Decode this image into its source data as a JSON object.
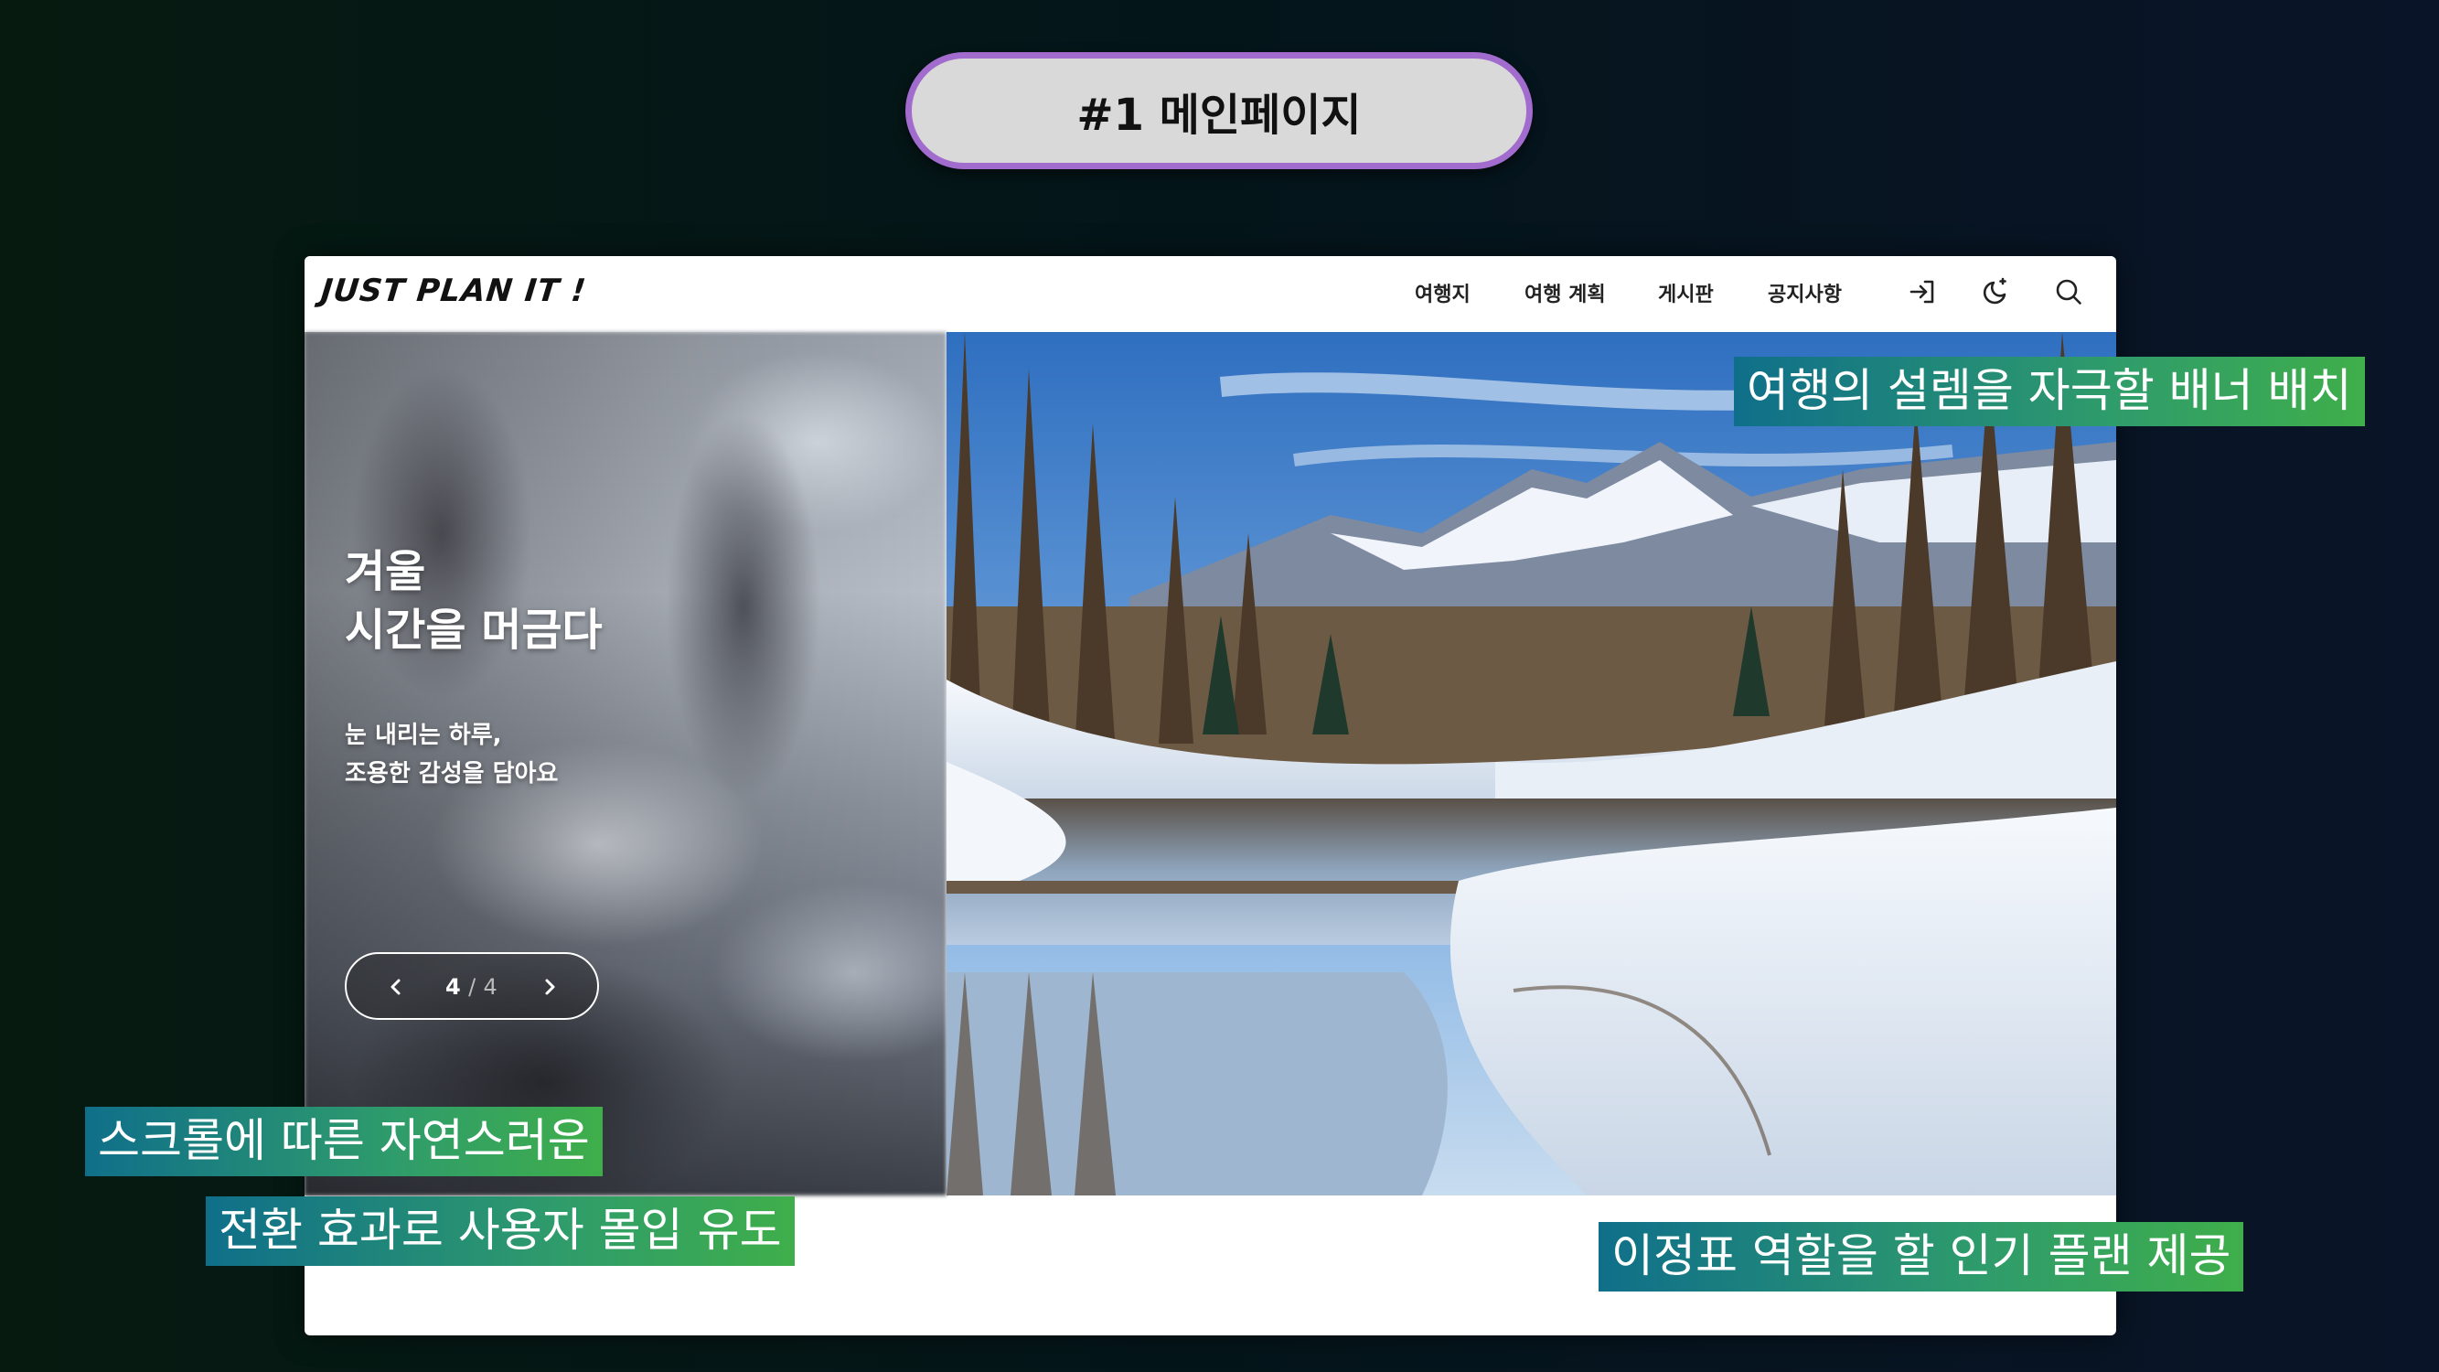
{
  "slide": {
    "title": "#1 메인페이지"
  },
  "site": {
    "logo": "JUST PLAN IT !",
    "nav": [
      "여행지",
      "여행 계획",
      "게시판",
      "공지사항"
    ],
    "icons": [
      "login-icon",
      "dark-mode-icon",
      "search-icon"
    ]
  },
  "hero": {
    "title_line1": "겨울",
    "title_line2": "시간을 머금다",
    "sub_line1": "눈 내리는 하루,",
    "sub_line2": "조용한 감성을 담아요",
    "pager": {
      "current": "4",
      "separator": "/",
      "total": "4"
    }
  },
  "callouts": {
    "banner": "여행의 설렘을 자극할 배너 배치",
    "scroll_line1": "스크롤에 따른 자연스러운",
    "scroll_line2": "전환 효과로 사용자 몰입 유도",
    "plans": "이정표 역할을 할 인기 플랜 제공"
  },
  "colors": {
    "pill_border": "#a26ccf",
    "pill_bg": "#d9d9d9",
    "callout_start": "#0f6f8a",
    "callout_end": "#3fae4a"
  }
}
